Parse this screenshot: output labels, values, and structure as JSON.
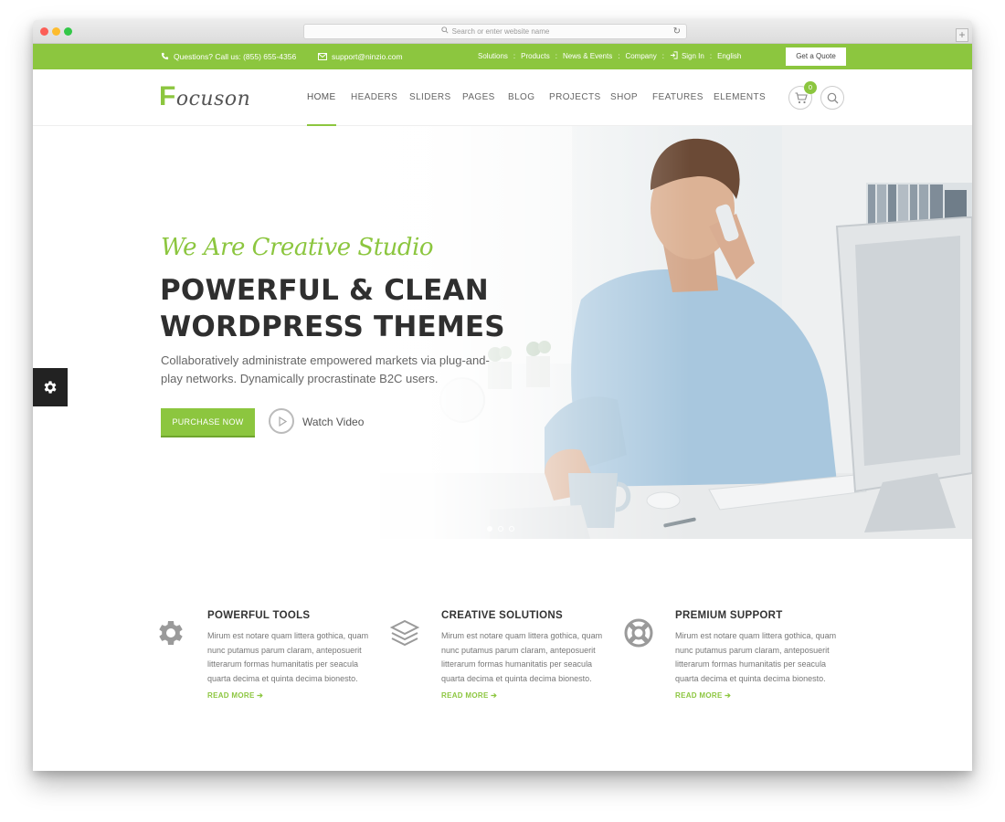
{
  "browser": {
    "url_placeholder": "Search or enter website name"
  },
  "topbar": {
    "phone": "Questions? Call us: (855) 655-4356",
    "email": "support@ninzio.com",
    "links": [
      "Solutions",
      "Products",
      "News & Events",
      "Company"
    ],
    "sign_in": "Sign In",
    "language": "English",
    "quote_button": "Get a Quote"
  },
  "header": {
    "logo_first": "F",
    "logo_rest": "ocuson",
    "nav": [
      "HOME",
      "HEADERS",
      "SLIDERS",
      "PAGES",
      "BLOG",
      "PROJECTS",
      "SHOP",
      "FEATURES",
      "ELEMENTS"
    ],
    "active_nav": "HOME",
    "cart_count": "0"
  },
  "hero": {
    "subtitle": "We Are Creative Studio",
    "title_line1": "POWERFUL & CLEAN",
    "title_line2": "WORDPRESS THEMES",
    "description": "Collaboratively administrate empowered markets via plug-and-play networks. Dynamically procrastinate B2C users.",
    "purchase_button": "PURCHASE NOW",
    "watch_video": "Watch Video",
    "slides_total": 3,
    "active_slide": 1
  },
  "features": [
    {
      "icon": "gear-icon",
      "title": "POWERFUL TOOLS",
      "text": "Mirum est notare quam littera gothica, quam nunc putamus parum claram, anteposuerit litterarum formas humanitatis per seacula quarta decima et quinta decima bionesto.",
      "more": "READ MORE"
    },
    {
      "icon": "layers-icon",
      "title": "CREATIVE SOLUTIONS",
      "text": "Mirum est notare quam littera gothica, quam nunc putamus parum claram, anteposuerit litterarum formas humanitatis per seacula quarta decima et quinta decima bionesto.",
      "more": "READ MORE"
    },
    {
      "icon": "lifebuoy-icon",
      "title": "PREMIUM SUPPORT",
      "text": "Mirum est notare quam littera gothica, quam nunc putamus parum claram, anteposuerit litterarum formas humanitatis per seacula quarta decima et quinta decima bionesto.",
      "more": "READ MORE"
    }
  ],
  "colors": {
    "accent": "#8cc63f",
    "dark_text": "#2f2f2f",
    "body_text": "#777777"
  }
}
